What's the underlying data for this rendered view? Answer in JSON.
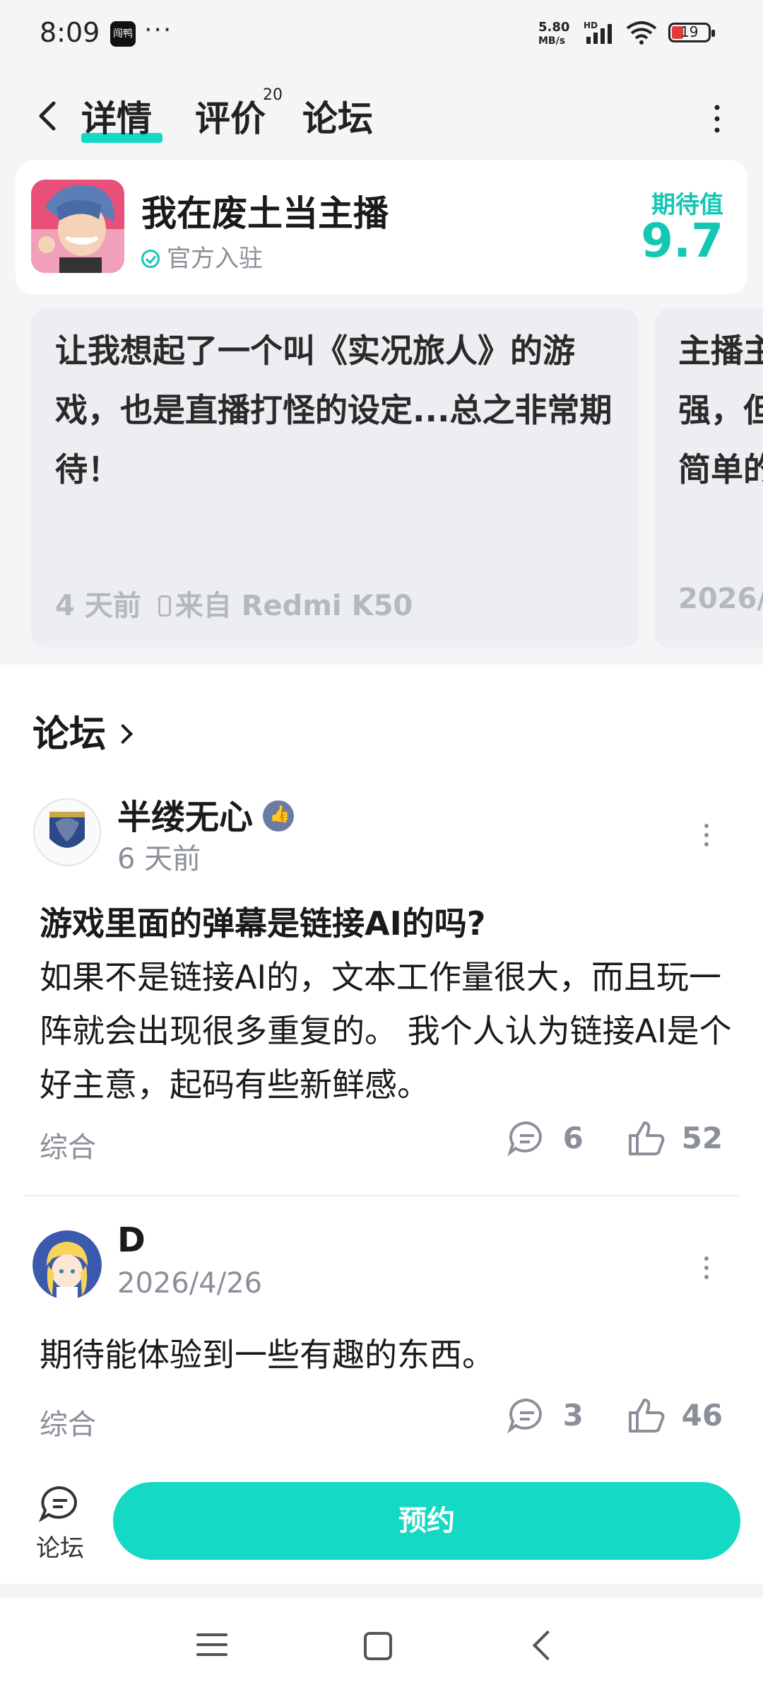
{
  "status_bar": {
    "time": "8:09",
    "app_icon_text": "闯鸭",
    "speed_top": "5.80",
    "speed_bottom": "MB/s",
    "hd": "HD",
    "battery": "19"
  },
  "header": {
    "tabs": [
      {
        "label": "详情",
        "active": true
      },
      {
        "label": "评价",
        "badge": "20"
      },
      {
        "label": "论坛"
      }
    ]
  },
  "game": {
    "title": "我在废土当主播",
    "official_label": "官方入驻",
    "anticipation_label": "期待值",
    "anticipation_score": "9.7"
  },
  "reviews": [
    {
      "text": "让我想起了一个叫《实况旅人》的游戏，也是直播打怪的设定...总之非常期待！",
      "time": "4 天前",
      "device": "来自 Redmi K50"
    },
    {
      "text": "主播主强，但简单的",
      "time": "2026/"
    }
  ],
  "forum": {
    "heading": "论坛",
    "posts": [
      {
        "username": "半缕无心",
        "time": "6 天前",
        "title": "游戏里面的弹幕是链接AI的吗?",
        "body": "如果不是链接AI的，文本工作量很大，而且玩一阵就会出现很多重复的。 我个人认为链接AI是个好主意，起码有些新鲜感。",
        "tag": "综合",
        "comments": "6",
        "likes": "52"
      },
      {
        "username": "D",
        "time": "2026/4/26",
        "body": "期待能体验到一些有趣的东西。",
        "tag": "综合",
        "comments": "3",
        "likes": "46"
      }
    ]
  },
  "bottom_bar": {
    "forum_tab_label": "论坛",
    "reserve_button": "预约"
  },
  "colors": {
    "accent": "#14d9c5",
    "score": "#14c7b3"
  }
}
